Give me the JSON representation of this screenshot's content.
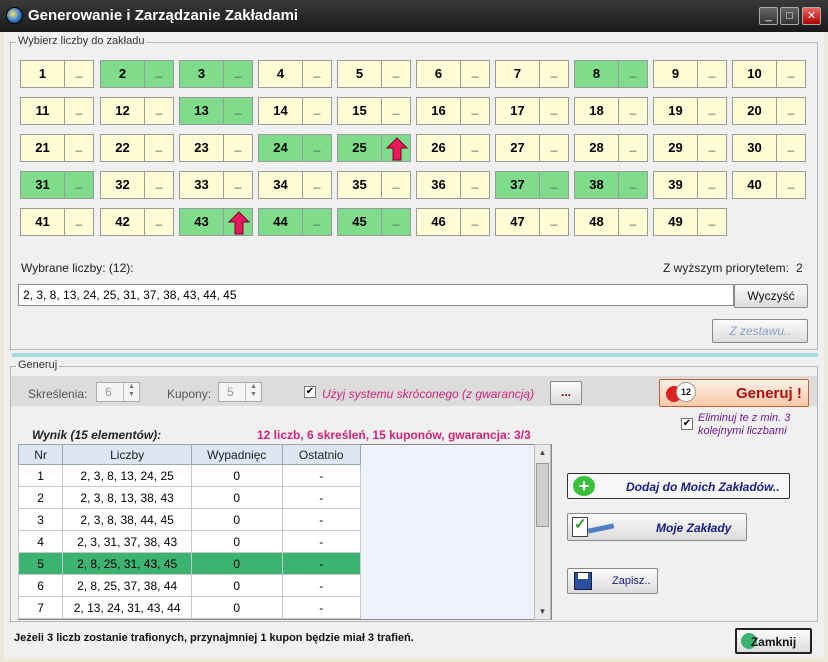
{
  "window": {
    "title": "Generowanie i Zarządzanie Zakładami",
    "minimize": "_",
    "maximize": "□",
    "close": "✕"
  },
  "pick_group": {
    "legend": "Wybierz liczby do zakładu"
  },
  "numbers": [
    {
      "n": "1",
      "sel": false,
      "pri": false
    },
    {
      "n": "2",
      "sel": true,
      "pri": false
    },
    {
      "n": "3",
      "sel": true,
      "pri": false
    },
    {
      "n": "4",
      "sel": false,
      "pri": false
    },
    {
      "n": "5",
      "sel": false,
      "pri": false
    },
    {
      "n": "6",
      "sel": false,
      "pri": false
    },
    {
      "n": "7",
      "sel": false,
      "pri": false
    },
    {
      "n": "8",
      "sel": true,
      "pri": false
    },
    {
      "n": "9",
      "sel": false,
      "pri": false
    },
    {
      "n": "10",
      "sel": false,
      "pri": false
    },
    {
      "n": "11",
      "sel": false,
      "pri": false
    },
    {
      "n": "12",
      "sel": false,
      "pri": false
    },
    {
      "n": "13",
      "sel": true,
      "pri": false
    },
    {
      "n": "14",
      "sel": false,
      "pri": false
    },
    {
      "n": "15",
      "sel": false,
      "pri": false
    },
    {
      "n": "16",
      "sel": false,
      "pri": false
    },
    {
      "n": "17",
      "sel": false,
      "pri": false
    },
    {
      "n": "18",
      "sel": false,
      "pri": false
    },
    {
      "n": "19",
      "sel": false,
      "pri": false
    },
    {
      "n": "20",
      "sel": false,
      "pri": false
    },
    {
      "n": "21",
      "sel": false,
      "pri": false
    },
    {
      "n": "22",
      "sel": false,
      "pri": false
    },
    {
      "n": "23",
      "sel": false,
      "pri": false
    },
    {
      "n": "24",
      "sel": true,
      "pri": false
    },
    {
      "n": "25",
      "sel": true,
      "pri": true
    },
    {
      "n": "26",
      "sel": false,
      "pri": false
    },
    {
      "n": "27",
      "sel": false,
      "pri": false
    },
    {
      "n": "28",
      "sel": false,
      "pri": false
    },
    {
      "n": "29",
      "sel": false,
      "pri": false
    },
    {
      "n": "30",
      "sel": false,
      "pri": false
    },
    {
      "n": "31",
      "sel": true,
      "pri": false
    },
    {
      "n": "32",
      "sel": false,
      "pri": false
    },
    {
      "n": "33",
      "sel": false,
      "pri": false
    },
    {
      "n": "34",
      "sel": false,
      "pri": false
    },
    {
      "n": "35",
      "sel": false,
      "pri": false
    },
    {
      "n": "36",
      "sel": false,
      "pri": false
    },
    {
      "n": "37",
      "sel": true,
      "pri": false
    },
    {
      "n": "38",
      "sel": true,
      "pri": false
    },
    {
      "n": "39",
      "sel": false,
      "pri": false
    },
    {
      "n": "40",
      "sel": false,
      "pri": false
    },
    {
      "n": "41",
      "sel": false,
      "pri": false
    },
    {
      "n": "42",
      "sel": false,
      "pri": false
    },
    {
      "n": "43",
      "sel": true,
      "pri": true
    },
    {
      "n": "44",
      "sel": true,
      "pri": false
    },
    {
      "n": "45",
      "sel": true,
      "pri": false
    },
    {
      "n": "46",
      "sel": false,
      "pri": false
    },
    {
      "n": "47",
      "sel": false,
      "pri": false
    },
    {
      "n": "48",
      "sel": false,
      "pri": false
    },
    {
      "n": "49",
      "sel": false,
      "pri": false
    }
  ],
  "priority_mark": "_",
  "selected": {
    "label": "Wybrane liczby: (12):",
    "priority_label": "Z wyższym priorytetem:",
    "priority_count": "2",
    "value": "2, 3, 8, 13, 24, 25, 31, 37, 38, 43, 44, 45",
    "clear_button": "Wyczyść",
    "from_set_button": "Z zestawu.."
  },
  "gen_group": {
    "legend": "Generuj",
    "skreslenia_label": "Skreślenia:",
    "skreslenia_value": "6",
    "kupony_label": "Kupony:",
    "kupony_value": "5",
    "system_checked": "✔",
    "system_label": "Użyj systemu skróconego (z gwarancją)",
    "more_button": "...",
    "generate_button": "Generuj !",
    "generate_badge": "12",
    "eliminate_checked": "✔",
    "eliminate_label": "Eliminuj te z min. 3 kolejnymi liczbami"
  },
  "result": {
    "title": "Wynik (15 elementów):",
    "summary": "12 liczb, 6 skreśleń, 15 kuponów, gwarancja: 3/3",
    "columns": [
      "Nr",
      "Liczby",
      "Wypadnięc",
      "Ostatnio"
    ],
    "rows": [
      [
        "1",
        "2, 3, 8, 13, 24, 25",
        "0",
        "-"
      ],
      [
        "2",
        "2, 3, 8, 13, 38, 43",
        "0",
        "-"
      ],
      [
        "3",
        "2, 3, 8, 38, 44, 45",
        "0",
        "-"
      ],
      [
        "4",
        "2, 3, 31, 37, 38, 43",
        "0",
        "-"
      ],
      [
        "5",
        "2, 8, 25, 31, 43, 45",
        "0",
        "-"
      ],
      [
        "6",
        "2, 8, 25, 37, 38, 44",
        "0",
        "-"
      ],
      [
        "7",
        "2, 13, 24, 31, 43, 44",
        "0",
        "-"
      ]
    ],
    "highlight_row": 4
  },
  "actions": {
    "add_button": "Dodaj do Moich Zakładów..",
    "my_bets_button": "Moje Zakłady",
    "save_button": "Zapisz.."
  },
  "status": "Jeżeli 3 liczb zostanie trafionych, przynajmniej 1 kupon będzie miał 3 trafień.",
  "close_button": "Zamknij",
  "colors": {
    "selected": "#7fdc8b",
    "unselected": "#fffdd6",
    "highlight": "#3cb371",
    "accent_pink": "#d4237a",
    "arrow": "#e8185a"
  }
}
